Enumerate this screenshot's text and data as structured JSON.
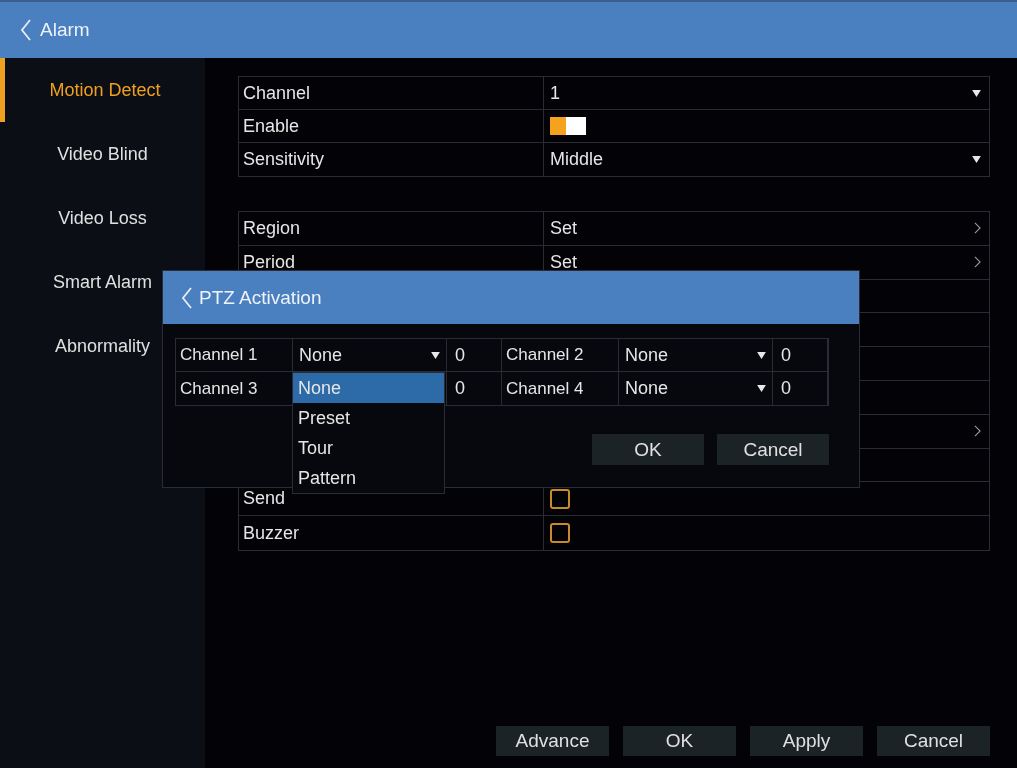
{
  "header": {
    "title": "Alarm"
  },
  "sidebar": {
    "items": [
      {
        "label": "Motion Detect",
        "selected": true
      },
      {
        "label": "Video Blind",
        "selected": false
      },
      {
        "label": "Video Loss",
        "selected": false
      },
      {
        "label": "Smart Alarm",
        "selected": false
      },
      {
        "label": "Abnormality",
        "selected": false
      }
    ]
  },
  "settings": {
    "groups": [
      {
        "rows": [
          {
            "kind": "select",
            "label": "Channel",
            "value": "1"
          },
          {
            "kind": "toggle",
            "label": "Enable",
            "on": true
          },
          {
            "kind": "select",
            "label": "Sensitivity",
            "value": "Middle"
          }
        ]
      },
      {
        "rows": [
          {
            "kind": "link",
            "label": "Region",
            "value": "Set"
          },
          {
            "kind": "link",
            "label": "Period",
            "value": "Set"
          },
          {
            "kind": "blank"
          },
          {
            "kind": "blank"
          },
          {
            "kind": "blank"
          },
          {
            "kind": "blank"
          },
          {
            "kind": "link"
          },
          {
            "kind": "blank"
          },
          {
            "kind": "checkbox",
            "label": "Send",
            "checked": false
          },
          {
            "kind": "checkbox",
            "label": "Buzzer",
            "checked": false
          }
        ]
      }
    ]
  },
  "buttons": [
    "Advance",
    "OK",
    "Apply",
    "Cancel"
  ],
  "dialog": {
    "title": "PTZ Activation",
    "channels": [
      {
        "label": "Channel 1",
        "mode": "None",
        "number": "0"
      },
      {
        "label": "Channel 2",
        "mode": "None",
        "number": "0"
      },
      {
        "label": "Channel 3",
        "number": "0"
      },
      {
        "label": "Channel 4",
        "mode": "None",
        "number": "0"
      }
    ],
    "dropdown": {
      "options": [
        {
          "label": "None",
          "selected": true
        },
        {
          "label": "Preset",
          "selected": false
        },
        {
          "label": "Tour",
          "selected": false
        },
        {
          "label": "Pattern",
          "selected": false
        }
      ]
    },
    "buttons": [
      "OK",
      "Cancel"
    ]
  }
}
